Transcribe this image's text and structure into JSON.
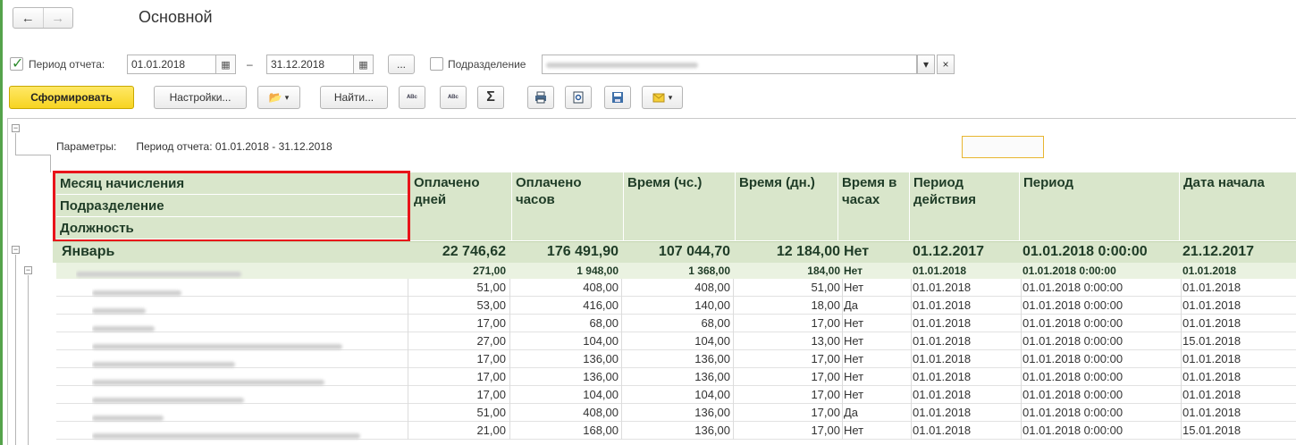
{
  "window": {
    "title": "Основной"
  },
  "filters": {
    "period_label": "Период отчета:",
    "date_from": "01.01.2018",
    "date_to": "31.12.2018",
    "dash": "–",
    "more_label": "...",
    "division_label": "Подразделение",
    "clear_label": "×",
    "dropdown_label": "▾"
  },
  "toolbar": {
    "generate_label": "Сформировать",
    "settings_label": "Настройки...",
    "find_label": "Найти...",
    "sum_label": "Σ"
  },
  "report": {
    "params_label": "Параметры:",
    "params_value": "Период отчета: 01.01.2018 - 31.12.2018",
    "group_headers": [
      "Месяц начисления",
      "Подразделение",
      "Должность"
    ],
    "columns": [
      "Оплачено дней",
      "Оплачено часов",
      "Время (чс.)",
      "Время (дн.)",
      "Время в часах",
      "Период действия",
      "Период",
      "Дата начала"
    ],
    "total_row": {
      "name": "Январь",
      "values": [
        "22 746,62",
        "176 491,90",
        "107 044,70",
        "12 184,00",
        "Нет",
        "01.12.2017",
        "01.01.2018 0:00:00",
        "21.12.2017"
      ]
    },
    "sub_row": {
      "values": [
        "271,00",
        "1 948,00",
        "1 368,00",
        "184,00",
        "Нет",
        "01.01.2018",
        "01.01.2018 0:00:00",
        "01.01.2018"
      ]
    },
    "rows": [
      [
        "51,00",
        "408,00",
        "408,00",
        "51,00",
        "Нет",
        "01.01.2018",
        "01.01.2018 0:00:00",
        "01.01.2018"
      ],
      [
        "53,00",
        "416,00",
        "140,00",
        "18,00",
        "Да",
        "01.01.2018",
        "01.01.2018 0:00:00",
        "01.01.2018"
      ],
      [
        "17,00",
        "68,00",
        "68,00",
        "17,00",
        "Нет",
        "01.01.2018",
        "01.01.2018 0:00:00",
        "01.01.2018"
      ],
      [
        "27,00",
        "104,00",
        "104,00",
        "13,00",
        "Нет",
        "01.01.2018",
        "01.01.2018 0:00:00",
        "15.01.2018"
      ],
      [
        "17,00",
        "136,00",
        "136,00",
        "17,00",
        "Нет",
        "01.01.2018",
        "01.01.2018 0:00:00",
        "01.01.2018"
      ],
      [
        "17,00",
        "136,00",
        "136,00",
        "17,00",
        "Нет",
        "01.01.2018",
        "01.01.2018 0:00:00",
        "01.01.2018"
      ],
      [
        "17,00",
        "104,00",
        "104,00",
        "17,00",
        "Нет",
        "01.01.2018",
        "01.01.2018 0:00:00",
        "01.01.2018"
      ],
      [
        "51,00",
        "408,00",
        "136,00",
        "17,00",
        "Да",
        "01.01.2018",
        "01.01.2018 0:00:00",
        "01.01.2018"
      ],
      [
        "21,00",
        "168,00",
        "136,00",
        "17,00",
        "Нет",
        "01.01.2018",
        "01.01.2018 0:00:00",
        "15.01.2018"
      ]
    ]
  },
  "colors": {
    "header_bg": "#d9e6cb",
    "header_text": "#1f3c27",
    "highlight_frame": "#e8141a",
    "primary_button": "#f7d421"
  }
}
